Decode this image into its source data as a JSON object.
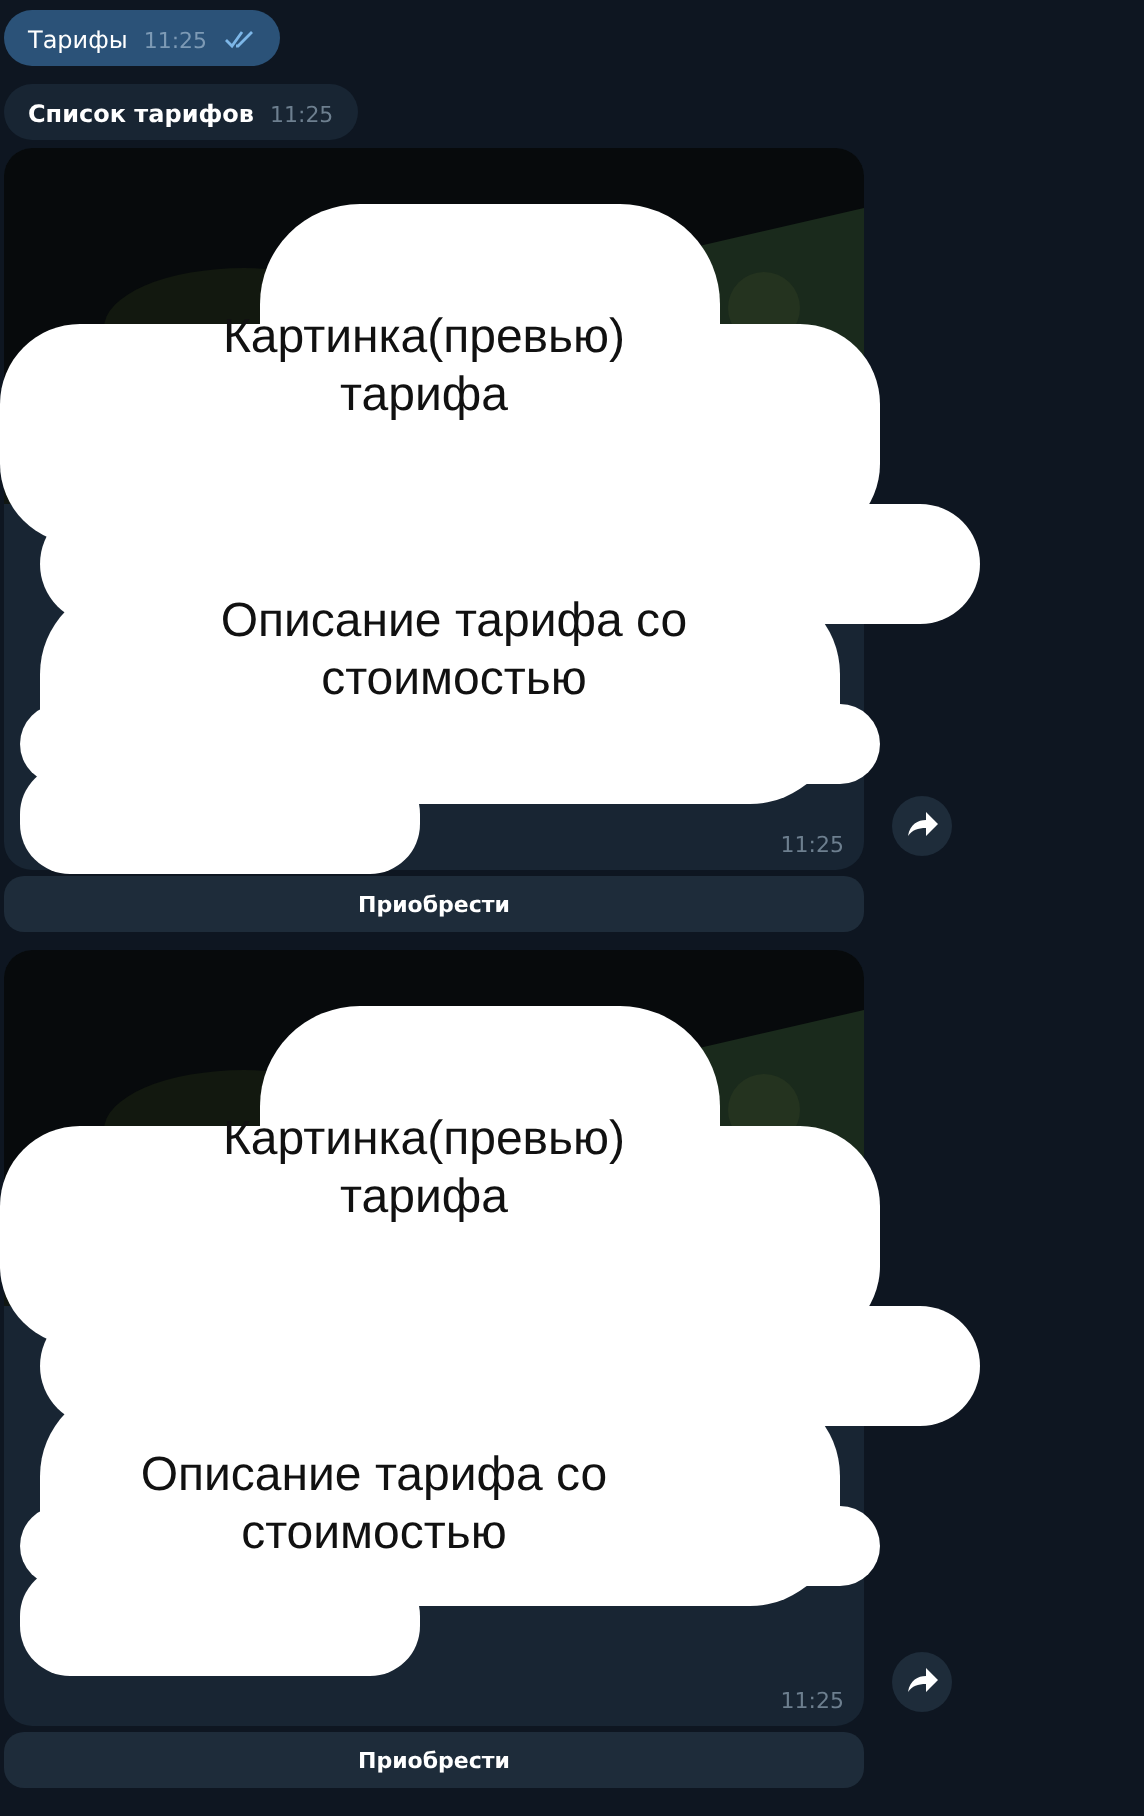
{
  "messages": [
    {
      "kind": "outgoing",
      "text": "Тарифы",
      "time": "11:25",
      "read": true
    },
    {
      "kind": "incoming",
      "text": "Список тарифов",
      "time": "11:25"
    },
    {
      "kind": "tariff",
      "picture_note": "Картинка(превью) тарифа",
      "description_note": "Описание тарифа со стоимостью",
      "time": "11:25",
      "button": "Приобрести"
    },
    {
      "kind": "tariff",
      "picture_note": "Картинка(превью) тарифа",
      "description_note": "Описание тарифа со стоимостью",
      "time": "11:25",
      "button": "Приобрести"
    }
  ]
}
